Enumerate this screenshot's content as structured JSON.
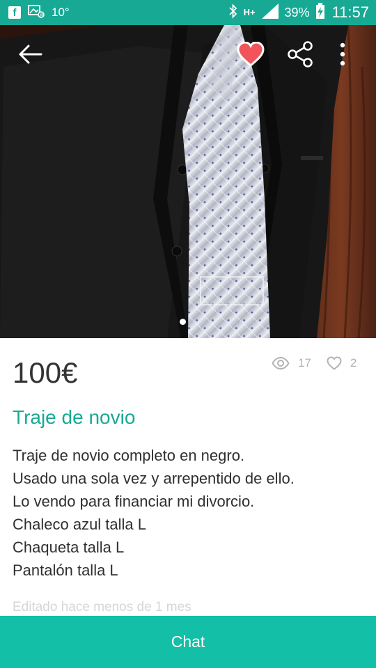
{
  "status_bar": {
    "temperature": "10°",
    "network": "H+",
    "battery": "39%",
    "time": "11:57"
  },
  "listing": {
    "price": "100€",
    "views": "17",
    "likes": "2",
    "title": "Traje de novio",
    "description": [
      "Traje de novio completo en negro.",
      "Usado una sola vez y arrepentido de ello.",
      "Lo vendo para financiar mi divorcio.",
      "Chaleco azul talla L",
      "Chaqueta talla L",
      "Pantalón talla L"
    ],
    "edited": "Editado hace menos de 1 mes"
  },
  "actions": {
    "chat_label": "Chat"
  },
  "icons": [
    "facebook-icon",
    "picture-mail-icon",
    "bluetooth-icon",
    "signal-icon",
    "battery-charging-icon",
    "back-arrow-icon",
    "heart-icon",
    "share-icon",
    "more-vert-icon",
    "eye-icon",
    "heart-outline-icon"
  ],
  "colors": {
    "accent": "#13bfa6",
    "status_bar": "#17a994",
    "favorite": "#f2545b"
  }
}
